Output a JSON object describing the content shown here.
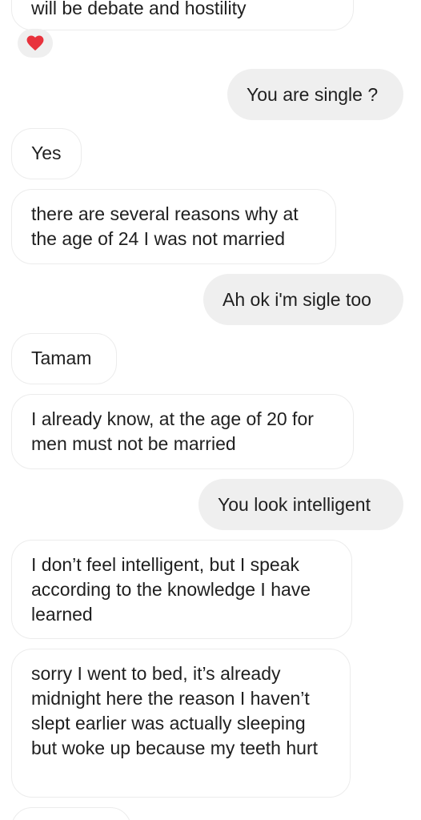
{
  "messages": [
    {
      "text": "will be debate and hostility"
    },
    {
      "text": "You are single ?"
    },
    {
      "text": "Yes"
    },
    {
      "text": "there are several reasons why at the age of 24 I was not married"
    },
    {
      "text": "Ah ok i'm sigle too"
    },
    {
      "text": "Tamam"
    },
    {
      "text": "I already know, at the age of 20 for men must not be married"
    },
    {
      "text": "You look intelligent"
    },
    {
      "text": "I don’t feel intelligent, but I speak according to the knowledge I have learned"
    },
    {
      "text": "sorry I went to bed, it’s already midnight here the reason I haven’t slept earlier was actually sleeping but woke up because my teeth hurt"
    },
    {
      "text": ""
    }
  ],
  "reaction": {
    "icon": "red-heart-icon",
    "color": "#e8323c"
  }
}
